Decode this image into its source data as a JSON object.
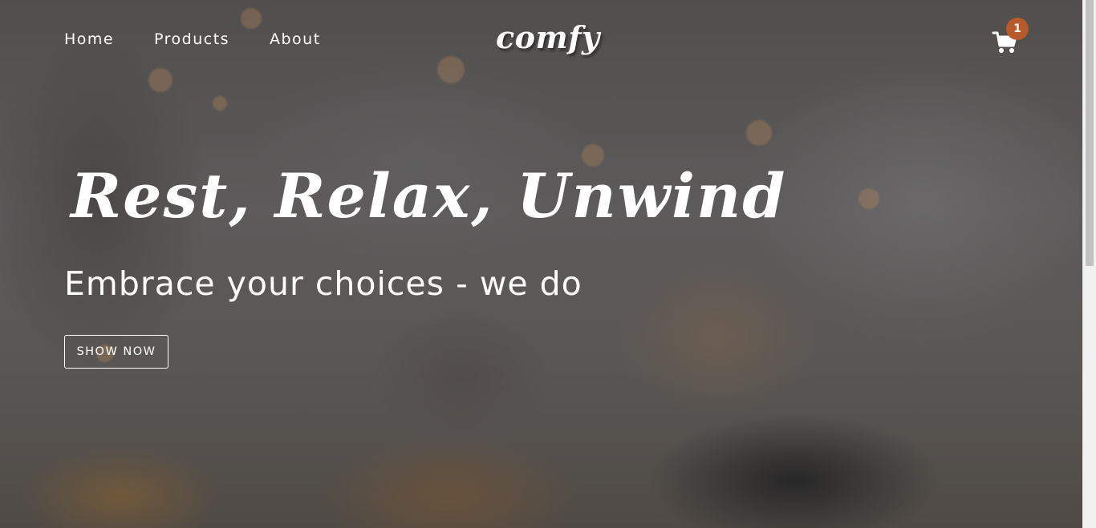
{
  "nav": {
    "links": [
      {
        "label": "Home"
      },
      {
        "label": "Products"
      },
      {
        "label": "About"
      }
    ],
    "logo": "comfy",
    "cart": {
      "icon": "cart-icon",
      "count": "1",
      "badge_color": "#b85b2c"
    }
  },
  "hero": {
    "title": "Rest, Relax, Unwind",
    "subtitle": "Embrace your choices - we do",
    "button_label": "SHOW NOW"
  },
  "colors": {
    "text": "#ffffff",
    "accent": "#b85b2c"
  }
}
